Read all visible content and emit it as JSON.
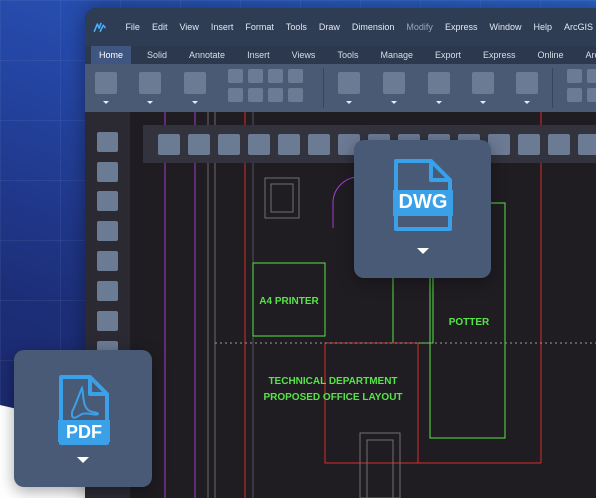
{
  "menu": [
    "File",
    "Edit",
    "View",
    "Insert",
    "Format",
    "Tools",
    "Draw",
    "Dimension",
    "Modify",
    "Express",
    "Window",
    "Help",
    "ArcGIS"
  ],
  "tabs": [
    "Home",
    "Solid",
    "Annotate",
    "Insert",
    "Views",
    "Tools",
    "Manage",
    "Export",
    "Express",
    "Online",
    "Arc"
  ],
  "drawing": {
    "label_printer": "A4 PRINTER",
    "label_potter": "POTTER",
    "label_dept": "TECHNICAL DEPARTMENT",
    "label_layout": "PROPOSED OFFICE LAYOUT"
  },
  "cards": {
    "dwg_label": "DWG",
    "pdf_label": "PDF"
  },
  "colors": {
    "accent_blue": "#3aa0e8",
    "cad_green": "#58e34a",
    "cad_red": "#d92a2a",
    "cad_purple": "#a040d0"
  }
}
